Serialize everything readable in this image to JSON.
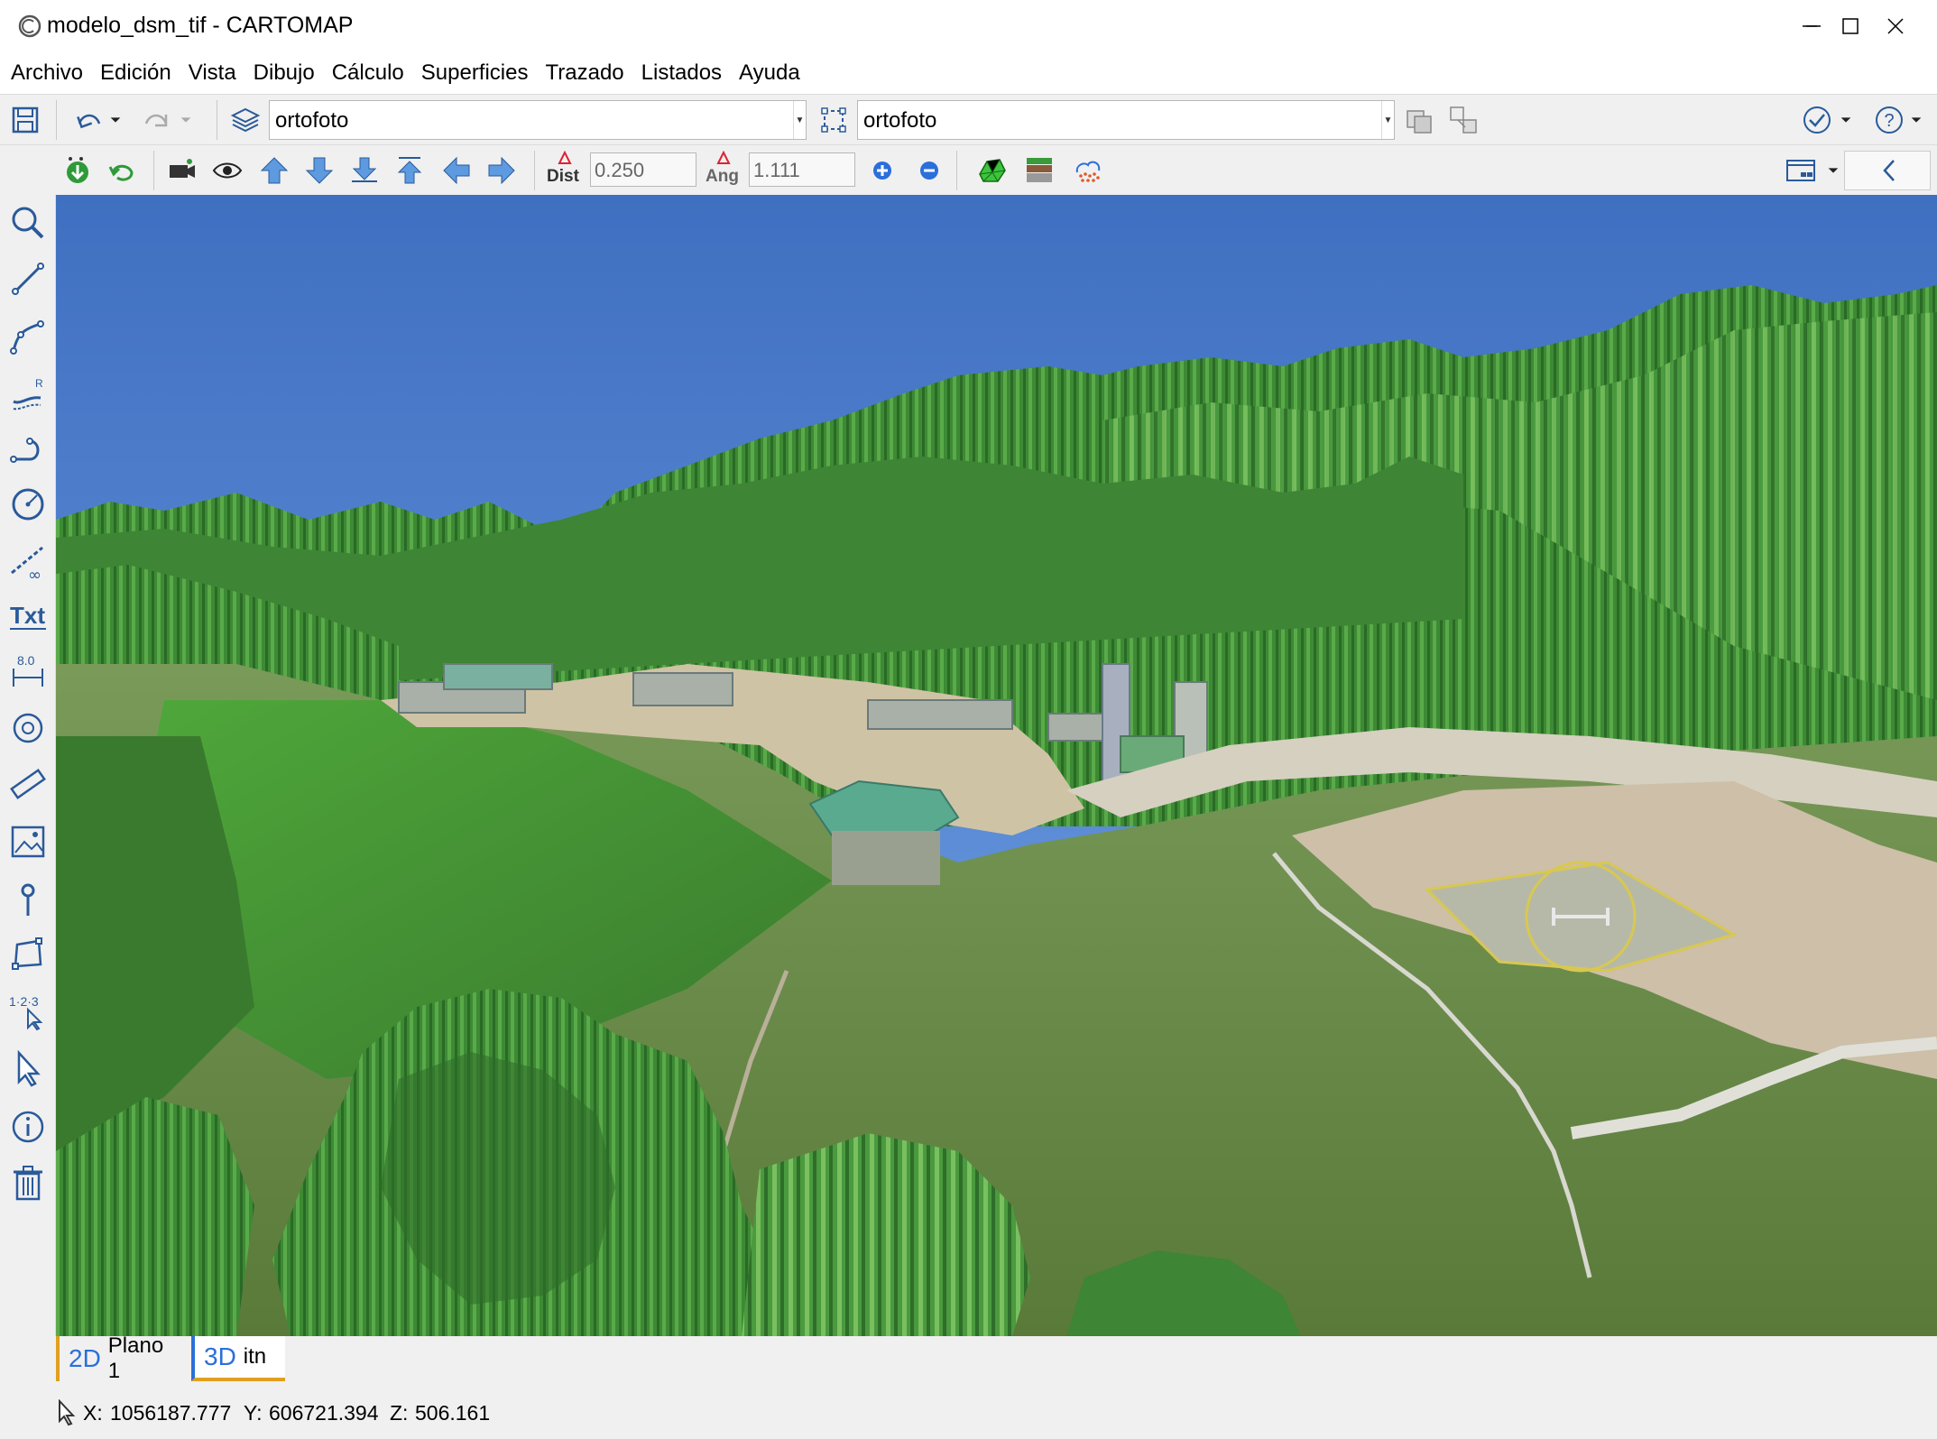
{
  "window": {
    "title": "modelo_dsm_tif - CARTOMAP",
    "minimize_icon": "minimize-icon",
    "maximize_icon": "maximize-icon",
    "close_icon": "close-icon"
  },
  "menu": [
    "Archivo",
    "Edición",
    "Vista",
    "Dibujo",
    "Cálculo",
    "Superficies",
    "Trazado",
    "Listados",
    "Ayuda"
  ],
  "toolbar": {
    "layer_combo_value": "ortofoto",
    "target_combo_value": "ortofoto",
    "dist_label": "Dist",
    "dist_value": "0.250",
    "ang_label": "Ang",
    "ang_value": "1.111"
  },
  "tabs": [
    {
      "kind": "2D",
      "label": "Plano 1",
      "accent": "#e0a020"
    },
    {
      "kind": "3D",
      "label": "itn",
      "accent": "#2a6fdb"
    }
  ],
  "status": {
    "x_label": "X:",
    "x_value": "1056187.777",
    "y_label": "Y:",
    "y_value": "606721.394",
    "z_label": "Z:",
    "z_value": "506.161"
  },
  "colors": {
    "sky_top": "#3f6fc0",
    "sky_bottom": "#6fa0e0",
    "vegetation": "#4f8f3a",
    "grass": "#5aa83c",
    "ground": "#c8bfa8"
  }
}
